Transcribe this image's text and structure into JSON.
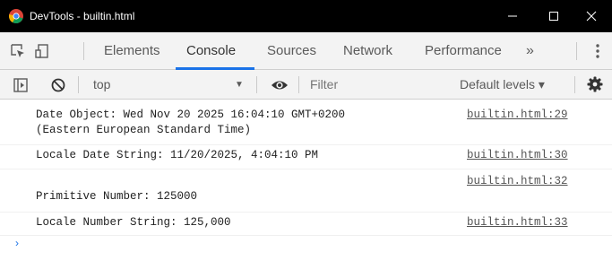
{
  "window": {
    "title": "DevTools - builtin.html",
    "controls": {
      "minimize": "—",
      "maximize": "☐",
      "close": "✕"
    }
  },
  "tabs": {
    "items": [
      {
        "label": "Elements",
        "active": false
      },
      {
        "label": "Console",
        "active": true
      },
      {
        "label": "Sources",
        "active": false
      },
      {
        "label": "Network",
        "active": false
      },
      {
        "label": "Performance",
        "active": false
      }
    ],
    "more_label": "»",
    "icons": [
      "inspect-element-icon",
      "device-toolbar-icon",
      "more-tabs-icon",
      "kebab-menu-icon"
    ]
  },
  "console_toolbar": {
    "context": "top",
    "filter_placeholder": "Filter",
    "levels_label": "Default levels ▾",
    "icons": [
      "sidebar-toggle-icon",
      "clear-console-icon",
      "eye-icon",
      "settings-gear-icon"
    ]
  },
  "messages": [
    {
      "text": "Date Object: Wed Nov 20 2025 16:04:10 GMT+0200\n(Eastern European Standard Time)",
      "source": "builtin.html:29"
    },
    {
      "text": "Locale Date String: 11/20/2025, 4:04:10 PM",
      "source": "builtin.html:30"
    },
    {
      "text": "\nPrimitive Number: 125000",
      "source": "builtin.html:32"
    },
    {
      "text": "Locale Number String: 125,000",
      "source": "builtin.html:33"
    }
  ],
  "prompt_symbol": "›",
  "colors": {
    "accent": "#1a73e8",
    "titlebar": "#000000",
    "toolbar_bg": "#f3f3f3"
  }
}
